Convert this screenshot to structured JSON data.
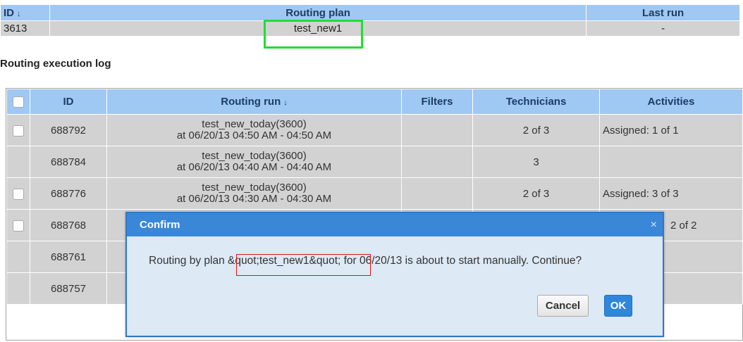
{
  "top_table": {
    "headers": {
      "id": "ID",
      "routing_plan": "Routing plan",
      "last_run": "Last run"
    },
    "sort_indicator": "↓",
    "row": {
      "id": "3613",
      "routing_plan": "test_new1",
      "last_run": "-"
    }
  },
  "log": {
    "title": "Routing execution log",
    "headers": {
      "id": "ID",
      "routing_run": "Routing run",
      "filters": "Filters",
      "technicians": "Technicians",
      "activities": "Activities"
    },
    "sort_indicator": "↓",
    "rows": [
      {
        "id": "688792",
        "run_name": "test_new_today(3600)",
        "run_time": "at 06/20/13 04:50 AM - 04:50 AM",
        "filters": "",
        "technicians": "2 of 3",
        "activities": "Assigned: 1 of 1"
      },
      {
        "id": "688784",
        "run_name": "test_new_today(3600)",
        "run_time": "at 06/20/13 04:40 AM - 04:40 AM",
        "filters": "",
        "technicians": "3",
        "activities": ""
      },
      {
        "id": "688776",
        "run_name": "test_new_today(3600)",
        "run_time": "at 06/20/13 04:30 AM - 04:30 AM",
        "filters": "",
        "technicians": "2 of 3",
        "activities": "Assigned: 3 of 3"
      },
      {
        "id": "688768",
        "run_name": "",
        "run_time": "",
        "filters": "",
        "technicians": "",
        "activities": "2 of 2"
      },
      {
        "id": "688761",
        "run_name": "",
        "run_time": "",
        "filters": "",
        "technicians": "",
        "activities": ""
      },
      {
        "id": "688757",
        "run_name": "",
        "run_time": "",
        "filters": "",
        "technicians": "",
        "activities": ""
      }
    ]
  },
  "dialog": {
    "title": "Confirm",
    "close_glyph": "×",
    "message": "Routing by plan &quot;test_new1&quot; for 06/20/13 is about to start manually. Continue?",
    "cancel_label": "Cancel",
    "ok_label": "OK"
  },
  "colors": {
    "header_bg": "#9fc8f3",
    "row_bg": "#d2d2d2",
    "dialog_title_bg": "#3a87d8",
    "dialog_bg": "#dde9f5",
    "ok_button": "#2f86dd",
    "highlight_green": "#22dd33",
    "highlight_red": "#e01515"
  },
  "icons": {
    "close": "close-icon",
    "sort": "sort-down-icon",
    "checkbox": "checkbox-icon"
  }
}
